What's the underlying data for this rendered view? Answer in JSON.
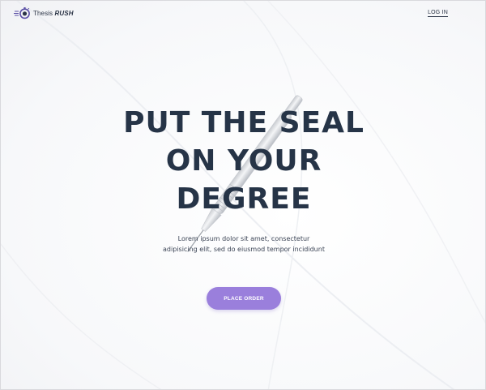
{
  "header": {
    "logo_prefix": "Thesis",
    "logo_brand": "RUSH",
    "login_label": "LOG IN"
  },
  "hero": {
    "headline_lines": [
      "PUT THE SEAL",
      "ON YOUR",
      "DEGREE"
    ],
    "subtext_lines": [
      "Lorem ipsum dolor sit amet, consectetur",
      "adipisicing elit, sed do eiusmod tempor incididunt"
    ],
    "cta_label": "PLACE ORDER"
  },
  "colors": {
    "heading": "#263447",
    "accent": "#9a7fdc",
    "logo_ring": "#5a4fa6"
  },
  "icons": {
    "logo": "stopwatch-icon",
    "hero_image": "pen-image"
  }
}
